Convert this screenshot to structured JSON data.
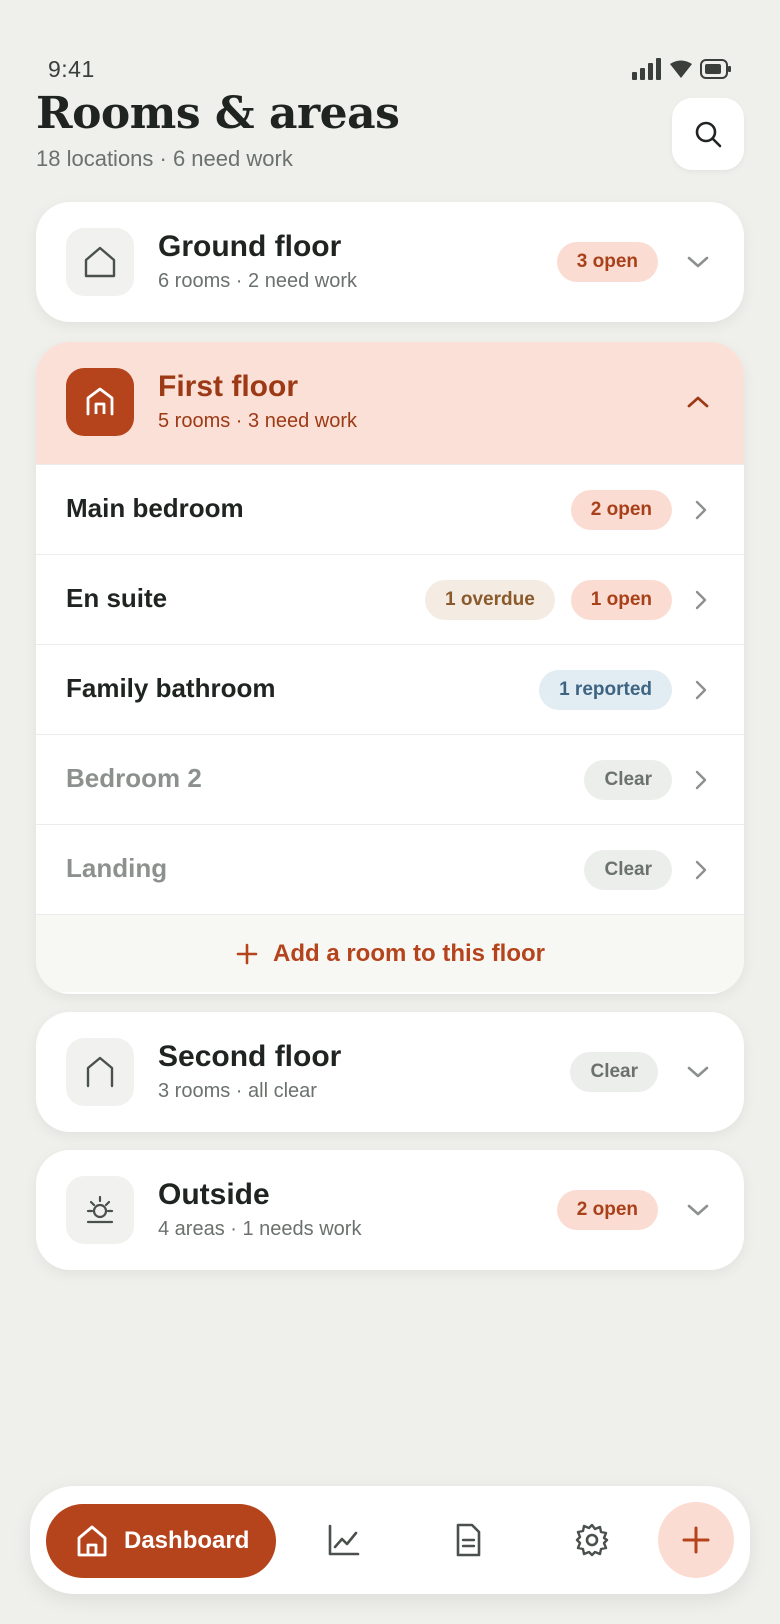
{
  "status_bar": {
    "time": "9:41"
  },
  "header": {
    "title": "Rooms & areas",
    "subtitle": "18 locations · 6 need work"
  },
  "floors": [
    {
      "name": "Ground floor",
      "summary": "6 rooms · 2 need work",
      "badge": "3 open",
      "icon": "house-outline-icon",
      "expanded": false
    },
    {
      "name": "First floor",
      "summary": "5 rooms · 3 need work",
      "icon": "house-filled-icon",
      "expanded": true,
      "rooms": [
        {
          "name": "Main bedroom",
          "badges": [
            "2 open"
          ]
        },
        {
          "name": "En suite",
          "badges": [
            "1 overdue",
            "1 open"
          ]
        },
        {
          "name": "Family bathroom",
          "badges": [
            "1 reported"
          ]
        },
        {
          "name": "Bedroom 2",
          "badges": [
            "Clear"
          ]
        },
        {
          "name": "Landing",
          "badges": [
            "Clear"
          ]
        }
      ],
      "add_room_label": "Add a room to this floor"
    },
    {
      "name": "Second floor",
      "summary": "3 rooms · all clear",
      "badge": "Clear",
      "icon": "roof-icon",
      "expanded": false
    },
    {
      "name": "Outside",
      "summary": "4 areas · 1 needs work",
      "badge": "2 open",
      "icon": "sun-icon",
      "expanded": false
    }
  ],
  "bottom_nav": {
    "dashboard_label": "Dashboard",
    "items": [
      "chart-icon",
      "document-icon",
      "gear-icon"
    ],
    "fab_icon": "plus-icon"
  },
  "colors": {
    "accent": "#b5431c",
    "accent_soft": "#fbe0d7",
    "background": "#efefeb"
  }
}
